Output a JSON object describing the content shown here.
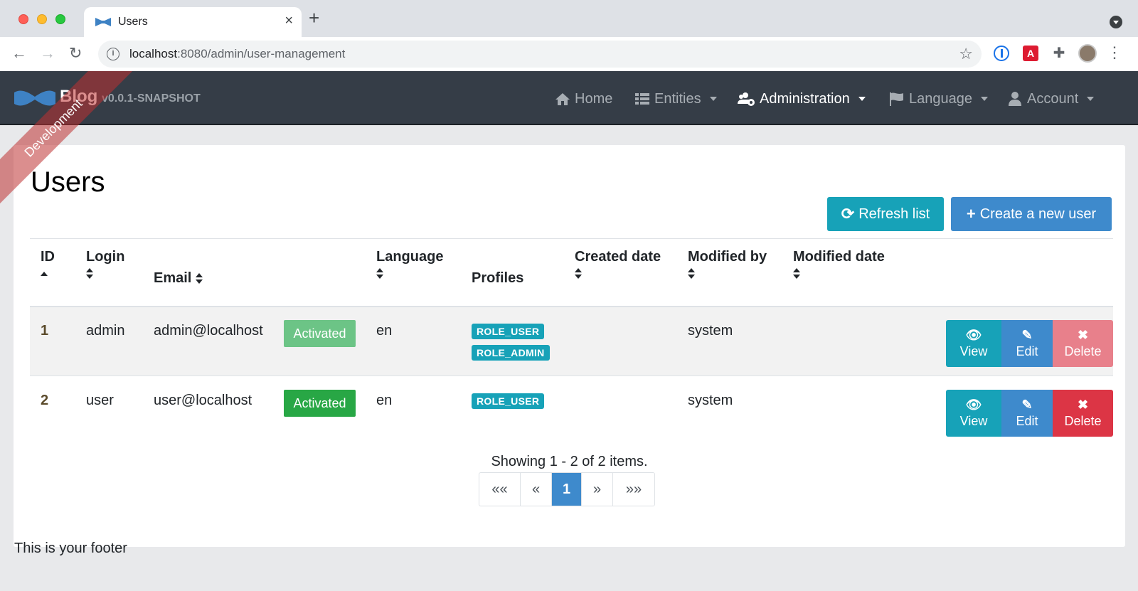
{
  "browser": {
    "tab_title": "Users",
    "close_glyph": "×",
    "new_tab_glyph": "+",
    "url_host": "localhost",
    "url_rest": ":8080/admin/user-management",
    "back_glyph": "←",
    "forward_glyph": "→",
    "reload_glyph": "↻",
    "star_glyph": "☆",
    "info_glyph": "i",
    "menu_glyph": "⋮",
    "ext_red_glyph": "A",
    "ext_puzzle_glyph": "✚"
  },
  "navbar": {
    "brand": "Blog",
    "version": "v0.0.1-SNAPSHOT",
    "items": [
      {
        "label": "Home",
        "icon": "home-icon",
        "dropdown": false
      },
      {
        "label": "Entities",
        "icon": "list-icon",
        "dropdown": true
      },
      {
        "label": "Administration",
        "icon": "users-cog-icon",
        "dropdown": true,
        "active": true
      },
      {
        "label": "Language",
        "icon": "flag-icon",
        "dropdown": true
      },
      {
        "label": "Account",
        "icon": "user-icon",
        "dropdown": true
      }
    ]
  },
  "ribbon": "Development",
  "page": {
    "title": "Users",
    "refresh_label": "Refresh list",
    "create_label": "Create a new user",
    "refresh_icon": "sync-icon",
    "create_icon": "plus-icon"
  },
  "table": {
    "headers": {
      "id": "ID",
      "login": "Login",
      "email": "Email",
      "language": "Language",
      "profiles": "Profiles",
      "created_date": "Created date",
      "modified_by": "Modified by",
      "modified_date": "Modified date"
    },
    "rows": [
      {
        "id": "1",
        "login": "admin",
        "email": "admin@localhost",
        "status": "Activated",
        "language": "en",
        "profiles": [
          "ROLE_USER",
          "ROLE_ADMIN"
        ],
        "created_date": "",
        "modified_by": "system",
        "modified_date": ""
      },
      {
        "id": "2",
        "login": "user",
        "email": "user@localhost",
        "status": "Activated",
        "language": "en",
        "profiles": [
          "ROLE_USER"
        ],
        "created_date": "",
        "modified_by": "system",
        "modified_date": ""
      }
    ],
    "actions": {
      "view": "View",
      "edit": "Edit",
      "delete": "Delete",
      "view_glyph": "👁",
      "edit_glyph": "✎",
      "delete_glyph": "✖"
    }
  },
  "pagination": {
    "summary": "Showing 1 - 2 of 2 items.",
    "first": "««",
    "prev": "«",
    "current": "1",
    "next": "»",
    "last": "»»"
  },
  "footer": "This is your footer",
  "colors": {
    "navbar": "#353d47",
    "info": "#17a2b8",
    "primary": "#3e8acc",
    "danger": "#dc3545",
    "success": "#28a745"
  }
}
